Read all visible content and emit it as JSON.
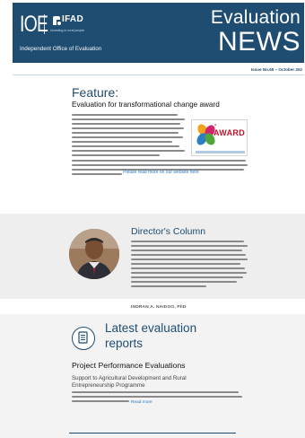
{
  "header": {
    "brand": "IOE",
    "partner": "IFAD",
    "partner_tagline": "Investing in rural people",
    "office": "Independent Office of Evaluation",
    "title_line1": "Evaluation",
    "title_line2": "NEWS",
    "color": "#1f4d72"
  },
  "issue": "Issue No.65 – October 202",
  "feature": {
    "heading": "Feature:",
    "subtitle": "Evaluation for transformational change award",
    "image_text": "AWARD",
    "link": "Please read more on our website here"
  },
  "director": {
    "heading": "Director's Column",
    "signature": "INDRAN A. NAIDOO, PhD"
  },
  "reports": {
    "heading_line1": "Latest evaluation",
    "heading_line2": "reports",
    "section": "Project Performance Evaluations",
    "project_line1": "Support to Agricultural Development and Rural",
    "project_line2": "Entrepreneurship Programme",
    "read_more": "Read more",
    "icon": "document-icon"
  }
}
